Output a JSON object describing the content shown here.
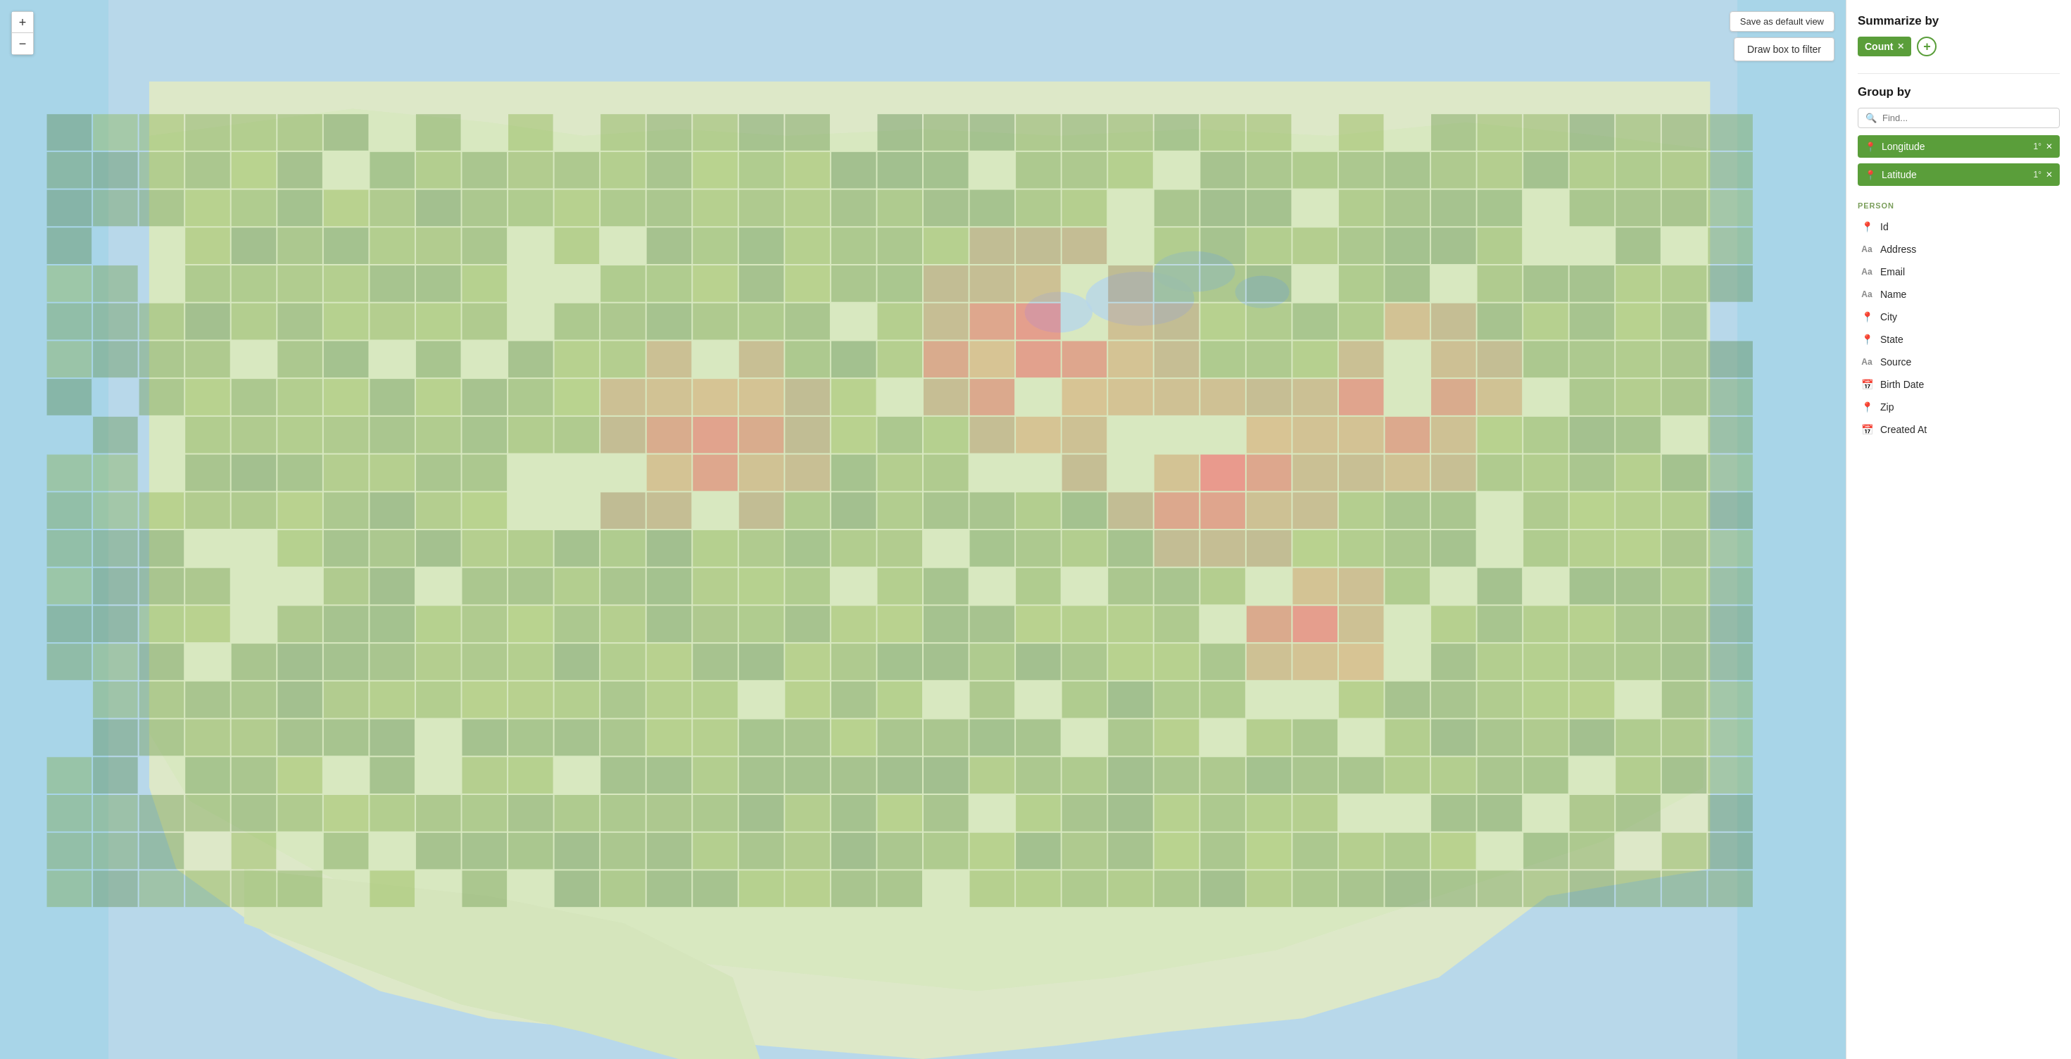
{
  "map": {
    "zoom_in_label": "+",
    "zoom_out_label": "−",
    "save_default_label": "Save as default view",
    "draw_filter_label": "Draw box to filter"
  },
  "panel": {
    "summarize_title": "Summarize by",
    "count_badge_label": "Count",
    "add_button_label": "+",
    "divider": true,
    "group_by_title": "Group by",
    "search_placeholder": "Find...",
    "group_pills": [
      {
        "label": "Longitude",
        "degree": "1°",
        "icon": "📍"
      },
      {
        "label": "Latitude",
        "degree": "1°",
        "icon": "📍"
      }
    ],
    "section_label": "PERSON",
    "fields": [
      {
        "label": "Id",
        "icon_type": "pin",
        "icon": "🔘"
      },
      {
        "label": "Address",
        "icon_type": "text",
        "icon": "Aa"
      },
      {
        "label": "Email",
        "icon_type": "text",
        "icon": "Aa"
      },
      {
        "label": "Name",
        "icon_type": "text",
        "icon": "Aa"
      },
      {
        "label": "City",
        "icon_type": "pin",
        "icon": "📍"
      },
      {
        "label": "State",
        "icon_type": "pin",
        "icon": "📍"
      },
      {
        "label": "Source",
        "icon_type": "text",
        "icon": "Aa"
      },
      {
        "label": "Birth Date",
        "icon_type": "calendar",
        "icon": "📅"
      },
      {
        "label": "Zip",
        "icon_type": "pin",
        "icon": "📍"
      },
      {
        "label": "Created At",
        "icon_type": "calendar",
        "icon": "📅"
      }
    ]
  },
  "colors": {
    "accent_green": "#5a9e3a",
    "pill_green": "#6aad42",
    "map_water": "#a8d5e8",
    "map_land": "#e8e8d8"
  }
}
